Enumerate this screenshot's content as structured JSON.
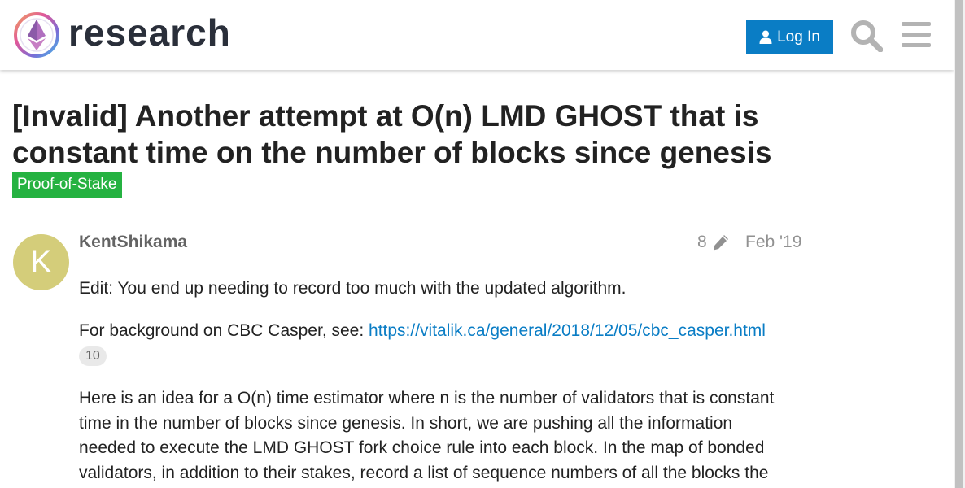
{
  "header": {
    "logo_text": "research",
    "login_label": "Log In",
    "icons": {
      "user": "user-icon",
      "search": "search-icon",
      "menu": "hamburger-menu-icon"
    },
    "accent_color": "#0a7dc5"
  },
  "topic": {
    "title": "[Invalid] Another attempt at O(n) LMD GHOST that is constant time on the number of blocks since genesis",
    "category": "Proof-of-Stake",
    "category_color": "#25b241"
  },
  "post": {
    "avatar_letter": "K",
    "avatar_color": "#d4cd7a",
    "username": "KentShikama",
    "edit_count": "8",
    "date": "Feb '19",
    "paragraph1": "Edit: You end up needing to record too much with the updated algorithm.",
    "paragraph2_prefix": "For background on CBC Casper, see: ",
    "paragraph2_link": "https://vitalik.ca/general/2018/12/05/cbc_casper.html",
    "link_clicks": "10",
    "paragraph3_lines": [
      "Here is an idea for a O(n) time estimator where n is the number of validators that is constant",
      "time in the number of blocks since genesis. In short, we are pushing all the information",
      "needed to execute the LMD GHOST fork choice rule into each block. In the map of bonded",
      "validators, in addition to their stakes, record a list of sequence numbers of all the blocks the"
    ]
  }
}
